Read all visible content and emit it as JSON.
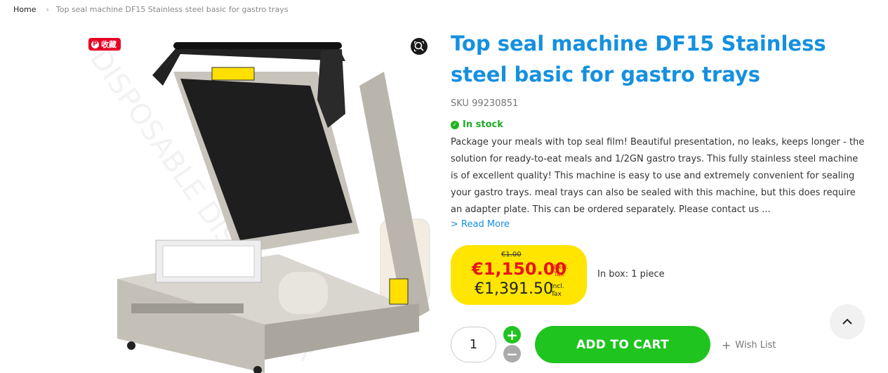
{
  "breadcrumb": {
    "home": "Home",
    "separator": "›",
    "current": "Top seal machine DF15 Stainless steel basic for gastro trays"
  },
  "gallery": {
    "pin_label": "收藏",
    "pin_icon": "pinterest-icon",
    "zoom_icon": "zoom-icon",
    "watermark": "DISPOSABLE DISTRIBUTER"
  },
  "product": {
    "title": "Top seal machine DF15 Stainless steel basic for gastro trays",
    "sku_label": "SKU",
    "sku": "99230851",
    "stock": "In stock",
    "description": "Package your meals with top seal film! Beautiful presentation, no leaks, keeps longer - the solution for ready-to-eat meals and 1/2GN gastro trays. This fully stainless steel machine is of excellent quality! This machine is easy to use and extremely convenient for sealing your gastro trays. meal trays can also be sealed with this machine, but this does require an adapter plate. This can be ordered separately. Please contact us ...",
    "read_more": "> Read More"
  },
  "price": {
    "old": "€1.00",
    "excl": "€1,150.00",
    "excl_label_1": "Excl.",
    "excl_label_2": "Tax",
    "incl": "€1,391.50",
    "incl_label_1": "Incl.",
    "incl_label_2": "Tax"
  },
  "in_box": "In box: 1 piece",
  "cart": {
    "quantity": "1",
    "plus": "+",
    "minus": "−",
    "add_label": "ADD TO CART",
    "wish_plus": "+",
    "wish_label": "Wish List"
  },
  "colors": {
    "accent_blue": "#1590e0",
    "cart_green": "#1fc41f",
    "price_yellow": "#ffe500",
    "price_red": "#e8141c",
    "pin_red": "#e60023"
  }
}
